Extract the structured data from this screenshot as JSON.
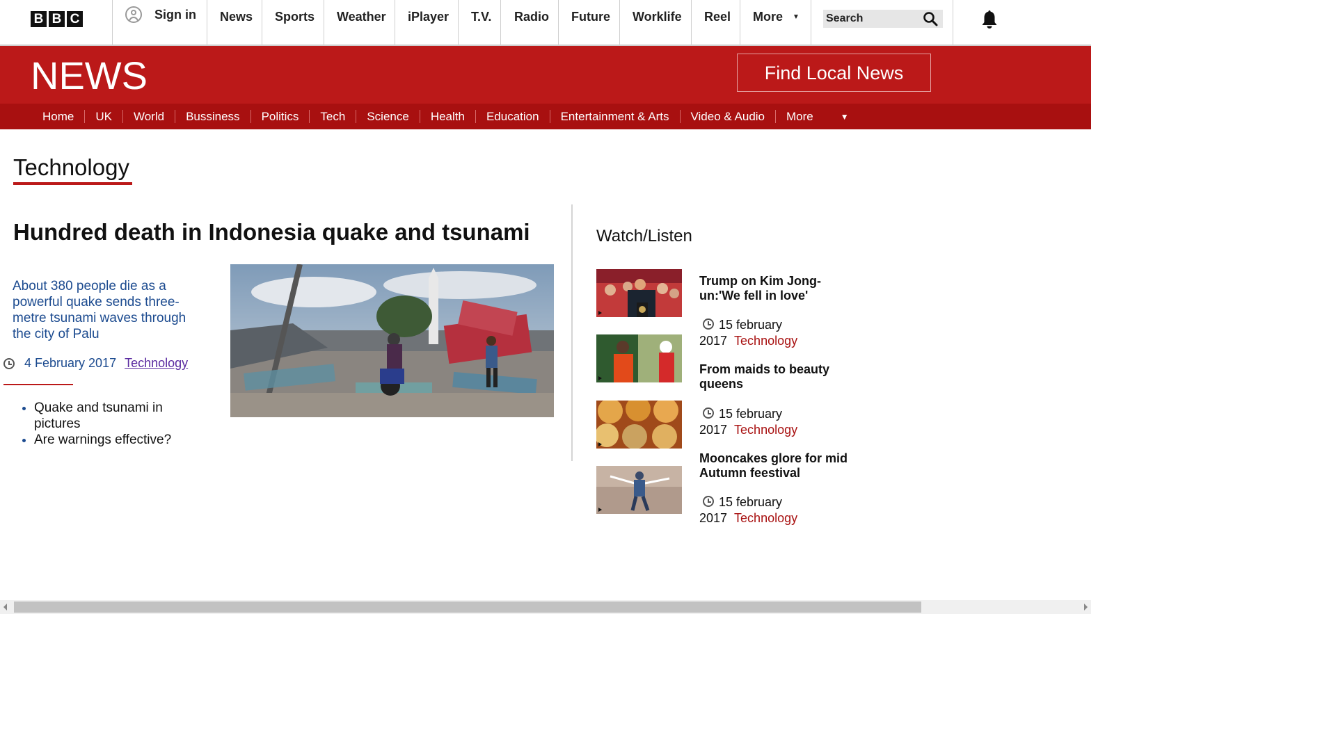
{
  "brand": {
    "letters": [
      "B",
      "B",
      "C"
    ]
  },
  "topnav": {
    "sign_in": "Sign in",
    "items": [
      "News",
      "Sports",
      "Weather",
      "iPlayer",
      "T.V.",
      "Radio",
      "Future",
      "Worklife",
      "Reel",
      "More"
    ],
    "search_placeholder": "Search"
  },
  "news_header": {
    "title": "NEWS",
    "local_button": "Find Local News"
  },
  "subnav": {
    "items": [
      "Home",
      "UK",
      "World",
      "Bussiness",
      "Politics",
      "Tech",
      "Science",
      "Health",
      "Education",
      "Entertainment & Arts",
      "Video & Audio",
      "More"
    ]
  },
  "section": {
    "title": "Technology"
  },
  "main_story": {
    "headline": "Hundred death in Indonesia quake and tsunami",
    "summary": "About 380 people die as a powerful quake sends three-metre tsunami waves through the city of Palu",
    "date": "4 February 2017",
    "category": "Technology",
    "related": [
      "Quake and tsunami in pictures",
      "Are warnings effective?"
    ]
  },
  "watch_listen": {
    "title": "Watch/Listen",
    "items": [
      {
        "headline": "Trump on Kim Jong-un:'We fell in love'",
        "date": "15 february 2017",
        "category": "Technology"
      },
      {
        "headline": "From maids to beauty queens",
        "date": "15 february 2017",
        "category": "Technology"
      },
      {
        "headline": "Mooncakes glore for mid Autumn feestival",
        "date": "15 february 2017",
        "category": "Technology"
      }
    ]
  },
  "colors": {
    "brand_red": "#bb1919",
    "subnav_red": "#a81010",
    "link_blue": "#1b4a8f",
    "category_red": "#a81010"
  }
}
